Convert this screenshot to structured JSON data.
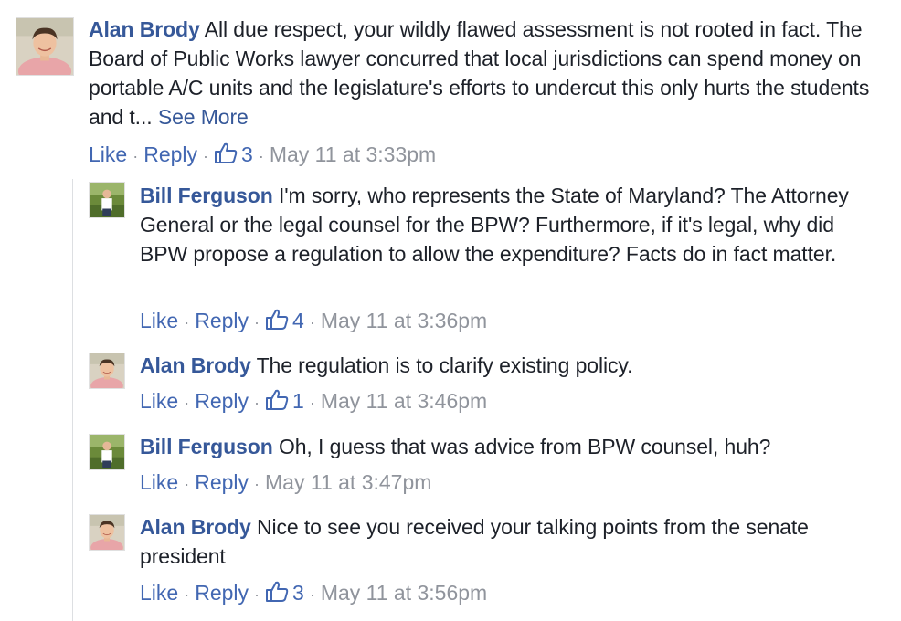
{
  "labels": {
    "like": "Like",
    "reply": "Reply",
    "dot": "·"
  },
  "comments": [
    {
      "author": "Alan Brody",
      "text": "All due respect, your wildly flawed assessment is not rooted in fact. The Board of Public Works lawyer concurred that local jurisdictions can spend money on portable A/C units and the legislature's efforts to undercut this only hurts the students and t...",
      "see_more": "See More",
      "like_count": "3",
      "timestamp": "May 11 at 3:33pm"
    },
    {
      "author": "Bill Ferguson",
      "text": "I'm sorry, who represents the State of Maryland? The Attorney General or the legal counsel for the BPW? Furthermore, if it's legal, why did BPW propose a regulation to allow the expenditure? Facts do in fact matter.",
      "like_count": "4",
      "timestamp": "May 11 at 3:36pm"
    },
    {
      "author": "Alan Brody",
      "text": "The regulation is to clarify existing policy.",
      "like_count": "1",
      "timestamp": "May 11 at 3:46pm"
    },
    {
      "author": "Bill Ferguson",
      "text": "Oh, I guess that was advice from BPW counsel, huh?",
      "timestamp": "May 11 at 3:47pm"
    },
    {
      "author": "Alan Brody",
      "text": "Nice to see you received your talking points from the senate president",
      "like_count": "3",
      "timestamp": "May 11 at 3:56pm"
    }
  ],
  "colors": {
    "link": "#365899",
    "action": "#4267b2",
    "meta": "#90949c",
    "text": "#1d2129"
  },
  "icons": {
    "like_count": "thumbs-up-outline-icon"
  }
}
